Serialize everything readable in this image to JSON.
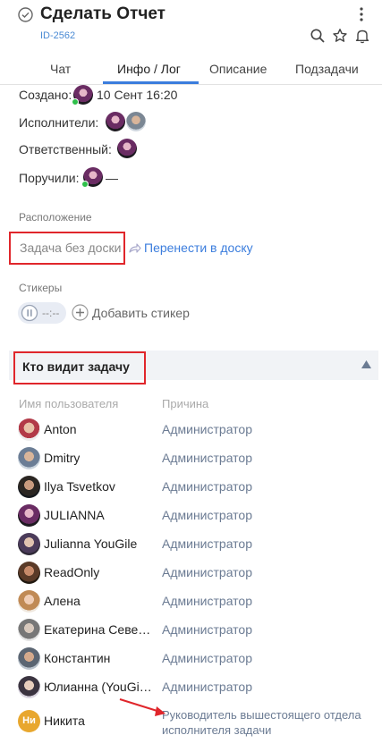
{
  "header": {
    "title": "Сделать Отчет",
    "task_id": "ID-2562",
    "icons": [
      "check-circle-icon",
      "more-vertical-icon",
      "search-icon",
      "star-icon",
      "bell-icon"
    ]
  },
  "tabs": [
    {
      "label": "Чат",
      "active": false
    },
    {
      "label": "Инфо / Лог",
      "active": true
    },
    {
      "label": "Описание",
      "active": false
    },
    {
      "label": "Подзадачи",
      "active": false
    }
  ],
  "info": {
    "created_label": "Создано:",
    "created_date": "10 Сент 16:20",
    "assignees_label": "Исполнители:",
    "responsible_label": "Ответственный:",
    "assigned_by_label": "Поручили:",
    "assigned_by_value": "—"
  },
  "location": {
    "label": "Расположение",
    "no_board": "Задача без доски",
    "move_link": "Перенести в доску"
  },
  "stickers": {
    "label": "Стикеры",
    "timer": "--:--",
    "add": "Добавить стикер"
  },
  "visibility": {
    "title": "Кто видит задачу",
    "col_user": "Имя пользователя",
    "col_reason": "Причина",
    "users": [
      {
        "name": "Anton",
        "reason": "Администратор"
      },
      {
        "name": "Dmitry",
        "reason": "Администратор"
      },
      {
        "name": "Ilya Tsvetkov",
        "reason": "Администратор"
      },
      {
        "name": "JULIANNA",
        "reason": "Администратор"
      },
      {
        "name": "Julianna YouGile",
        "reason": "Администратор"
      },
      {
        "name": "ReadOnly",
        "reason": "Администратор"
      },
      {
        "name": "Алена",
        "reason": "Администратор"
      },
      {
        "name": "Екатерина Северова",
        "reason": "Администратор"
      },
      {
        "name": "Константин",
        "reason": "Администратор"
      },
      {
        "name": "Юлианна (YouGile)",
        "reason": "Администратор"
      }
    ],
    "last_user": {
      "initials": "Ни",
      "name": "Никита",
      "reason_line1": "Руководитель вышестоящего отдела",
      "reason_line2": "исполнителя задачи"
    }
  },
  "colors": {
    "accent": "#3b7ddd",
    "highlight_box": "#e0262b",
    "reason_text": "#6b7b93",
    "initials_bg": "#e8a72e"
  }
}
